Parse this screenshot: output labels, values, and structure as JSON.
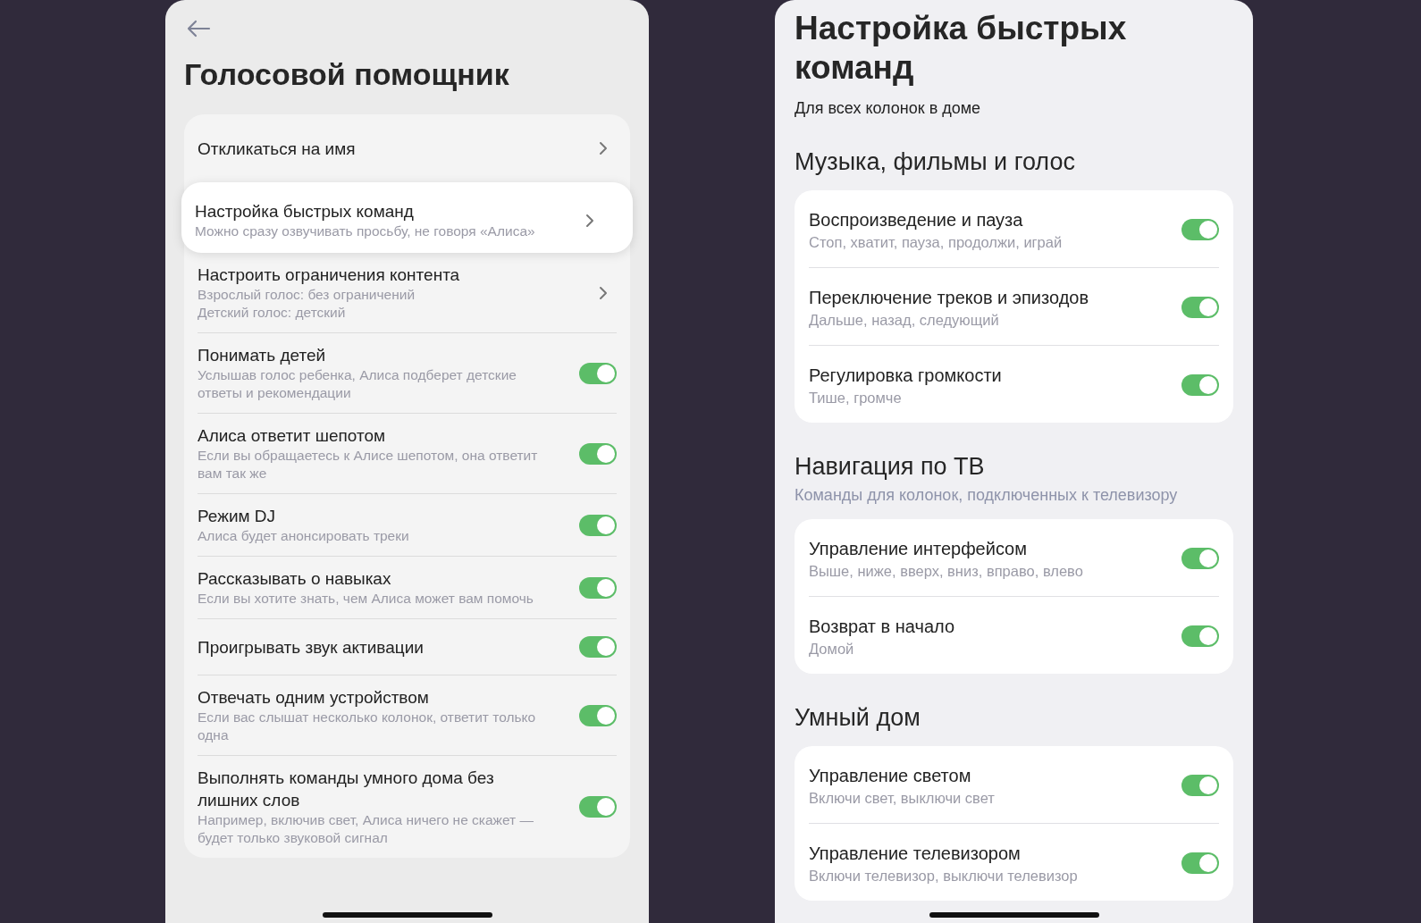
{
  "left": {
    "title": "Голосовой помощник",
    "items": [
      {
        "kind": "link",
        "title": "Откликаться на имя",
        "highlighted": false
      },
      {
        "kind": "link",
        "title": "Настройка быстрых команд",
        "subtitle": [
          "Можно сразу озвучивать просьбу, не говоря «Алиса»"
        ],
        "highlighted": true
      },
      {
        "kind": "link",
        "title": "Настроить ограничения контента",
        "subtitle": [
          "Взрослый голос: без ограничений",
          "Детский голос: детский"
        ],
        "highlighted": false
      },
      {
        "kind": "toggle",
        "title": "Понимать детей",
        "subtitle": [
          "Услышав голос ребенка, Алиса подберет детские ответы и рекомендации"
        ],
        "on": true,
        "highlighted": false
      },
      {
        "kind": "toggle",
        "title": "Алиса ответит шепотом",
        "subtitle": [
          "Если вы обращаетесь к Алисе шепотом, она ответит вам так же"
        ],
        "on": true,
        "highlighted": false
      },
      {
        "kind": "toggle",
        "title": "Режим DJ",
        "subtitle": [
          "Алиса будет анонсировать треки"
        ],
        "on": true,
        "highlighted": false
      },
      {
        "kind": "toggle",
        "title": "Рассказывать о навыках",
        "subtitle": [
          "Если вы хотите знать, чем Алиса может вам помочь"
        ],
        "on": true,
        "highlighted": false
      },
      {
        "kind": "toggle",
        "title": "Проигрывать звук активации",
        "on": true,
        "highlighted": false
      },
      {
        "kind": "toggle",
        "title": "Отвечать одним устройством",
        "subtitle": [
          "Если вас слышат несколько колонок, ответит только одна"
        ],
        "on": true,
        "highlighted": false
      },
      {
        "kind": "toggle",
        "title": "Выполнять команды умного дома без лишних слов",
        "subtitle": [
          "Например, включив свет, Алиса ничего не скажет — будет только звуковой сигнал"
        ],
        "on": true,
        "highlighted": false
      }
    ]
  },
  "right": {
    "title": "Настройка быстрых команд",
    "subtitle": "Для всех колонок в доме",
    "sections": [
      {
        "heading": "Музыка, фильмы и голос",
        "items": [
          {
            "title": "Воспроизведение и пауза",
            "subtitle": "Стоп, хватит, пауза, продолжи, играй",
            "on": true
          },
          {
            "title": "Переключение треков и эпизодов",
            "subtitle": "Дальше, назад, следующий",
            "on": true
          },
          {
            "title": "Регулировка громкости",
            "subtitle": "Тише, громче",
            "on": true
          }
        ]
      },
      {
        "heading": "Навигация по ТВ",
        "note": "Команды для колонок, подключенных к телевизору",
        "items": [
          {
            "title": "Управление интерфейсом",
            "subtitle": "Выше, ниже, вверх, вниз, вправо, влево",
            "on": true
          },
          {
            "title": "Возврат в начало",
            "subtitle": "Домой",
            "on": true
          }
        ]
      },
      {
        "heading": "Умный дом",
        "items": [
          {
            "title": "Управление светом",
            "subtitle": "Включи свет, выключи свет",
            "on": true
          },
          {
            "title": "Управление телевизором",
            "subtitle": "Включи телевизор, выключи телевизор",
            "on": true
          }
        ]
      }
    ]
  }
}
